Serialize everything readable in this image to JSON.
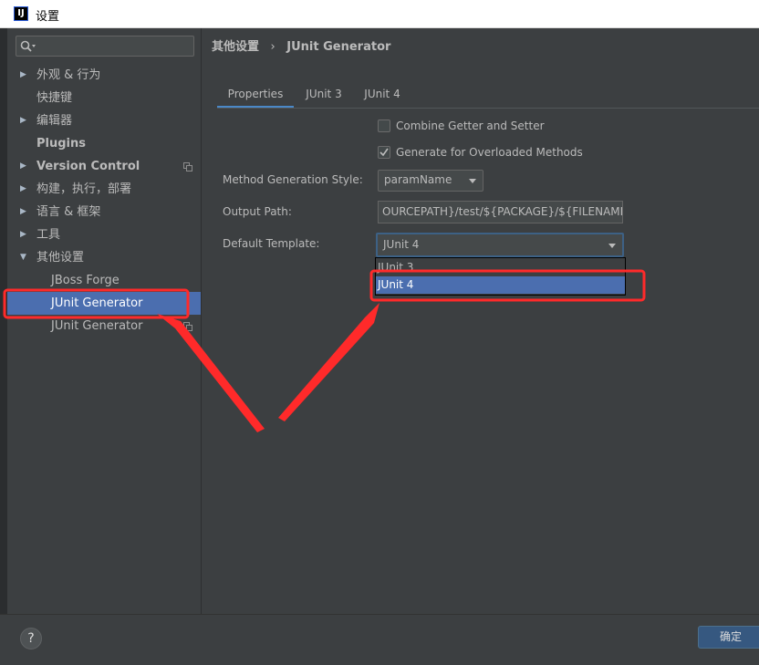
{
  "window": {
    "title": "设置",
    "icon": "intellij-logo-icon"
  },
  "sidebar": {
    "search_placeholder": "",
    "items": [
      {
        "label": "外观 & 行为",
        "expandable": true,
        "expanded": false
      },
      {
        "label": "快捷键",
        "expandable": false
      },
      {
        "label": "编辑器",
        "expandable": true,
        "expanded": false
      },
      {
        "label": "Plugins",
        "expandable": false
      },
      {
        "label": "Version Control",
        "expandable": true,
        "expanded": false,
        "has_copy_icon": true
      },
      {
        "label": "构建，执行，部署",
        "expandable": true,
        "expanded": false
      },
      {
        "label": "语言 & 框架",
        "expandable": true,
        "expanded": false
      },
      {
        "label": "工具",
        "expandable": true,
        "expanded": false
      },
      {
        "label": "其他设置",
        "expandable": true,
        "expanded": true
      },
      {
        "label": "JBoss Forge",
        "child": true
      },
      {
        "label": "JUnit Generator",
        "child": true,
        "selected": true
      },
      {
        "label": "JUnit Generator",
        "child": true,
        "has_copy_icon": true
      }
    ]
  },
  "main": {
    "breadcrumb": {
      "parent": "其他设置",
      "separator": "›",
      "current": "JUnit Generator"
    },
    "tabs": [
      {
        "label": "Properties",
        "active": true
      },
      {
        "label": "JUnit 3",
        "active": false
      },
      {
        "label": "JUnit 4",
        "active": false
      }
    ],
    "checkboxes": {
      "combine": {
        "label": "Combine Getter and Setter",
        "checked": false
      },
      "overloaded": {
        "label": "Generate for Overloaded Methods",
        "checked": true
      }
    },
    "method_style": {
      "label": "Method Generation Style:",
      "value": "paramName"
    },
    "output_path": {
      "label": "Output Path:",
      "value": "OURCEPATH}/test/${PACKAGE}/${FILENAME}"
    },
    "default_template": {
      "label": "Default Template:",
      "value": "JUnit 4",
      "options": [
        "JUnit 3",
        "JUnit 4"
      ],
      "highlighted_option": "JUnit 4"
    }
  },
  "footer": {
    "help_label": "?",
    "ok_label": "确定"
  },
  "colors": {
    "selection": "#4b6eaf",
    "annotation": "#ff2a2a",
    "tab_underline": "#4a88c7",
    "background": "#3c3f41"
  }
}
